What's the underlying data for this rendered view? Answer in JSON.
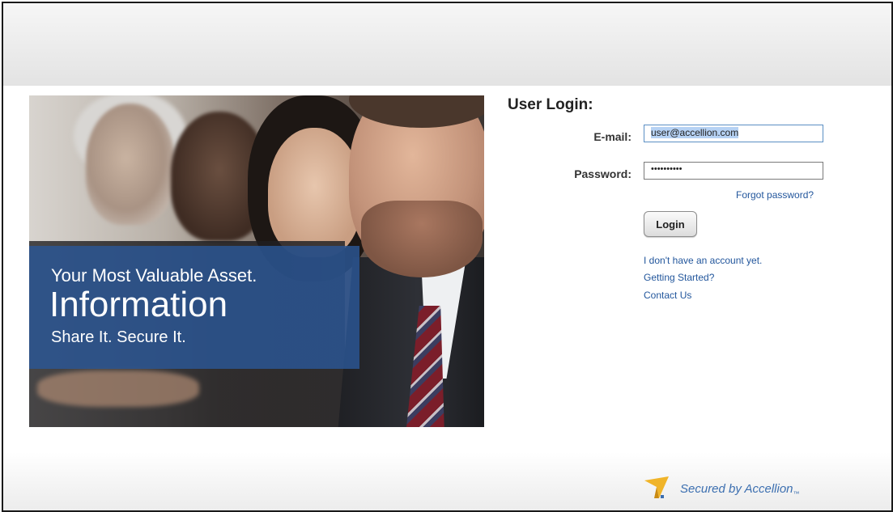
{
  "hero": {
    "line1": "Your Most Valuable Asset.",
    "line2": "Information",
    "line3": "Share It. Secure It."
  },
  "login": {
    "title": "User Login:",
    "email_label": "E-mail:",
    "email_value": "user@accellion.com",
    "password_label": "Password:",
    "password_mask": "••••••••••",
    "forgot_link": "Forgot password?",
    "login_button": "Login",
    "links": [
      "I don't have an account yet.",
      "Getting Started?",
      "Contact Us"
    ]
  },
  "footer": {
    "brand_text": "Secured by Accellion",
    "brand_mark": "™"
  },
  "colors": {
    "link": "#22569c",
    "banner": "#2b5796",
    "logo_gold": "#f0b429",
    "logo_blue": "#3c6fb0"
  },
  "icons": [
    "accellion-logo-icon"
  ]
}
